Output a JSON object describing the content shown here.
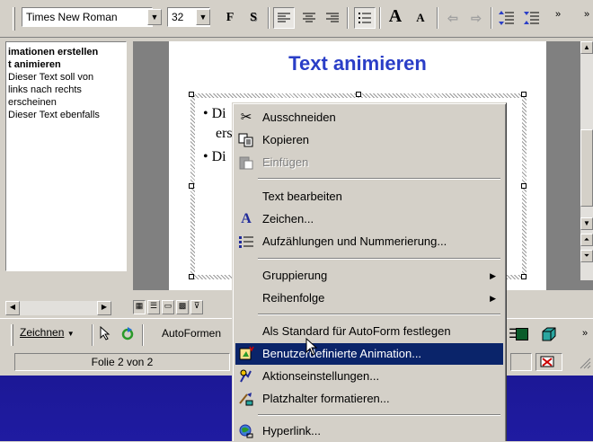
{
  "toolbar": {
    "font_name": "Times New Roman",
    "font_size": "32",
    "bold_label": "F",
    "shadow_label": "S",
    "grow_label": "A",
    "shrink_label": "A"
  },
  "outline": {
    "lines": [
      "imationen erstellen",
      "t animieren",
      "Dieser Text soll von",
      "links nach rechts",
      "erscheinen",
      "Dieser Text ebenfalls"
    ]
  },
  "slide": {
    "title": "Text animieren",
    "bullet1_part1": "Di",
    "bullet1_part2": "ers",
    "bullet2": "Di"
  },
  "drawbar": {
    "draw_label": "Zeichnen",
    "autoshapes_label": "AutoFormen"
  },
  "status": {
    "slide_info": "Folie 2 von 2"
  },
  "context_menu": {
    "cut": "Ausschneiden",
    "copy": "Kopieren",
    "paste": "Einfügen",
    "edit_text": "Text bearbeiten",
    "font": "Zeichen...",
    "bullets": "Aufzählungen und Nummerierung...",
    "grouping": "Gruppierung",
    "order": "Reihenfolge",
    "set_default": "Als Standard für AutoForm festlegen",
    "custom_animation": "Benutzerdefinierte Animation...",
    "action_settings": "Aktionseinstellungen...",
    "format_placeholder": "Platzhalter formatieren...",
    "hyperlink": "Hyperlink..."
  },
  "colors": {
    "title_blue": "#2a3ec7",
    "menu_highlight": "#0a246a",
    "taskbar": "#1c1896"
  }
}
